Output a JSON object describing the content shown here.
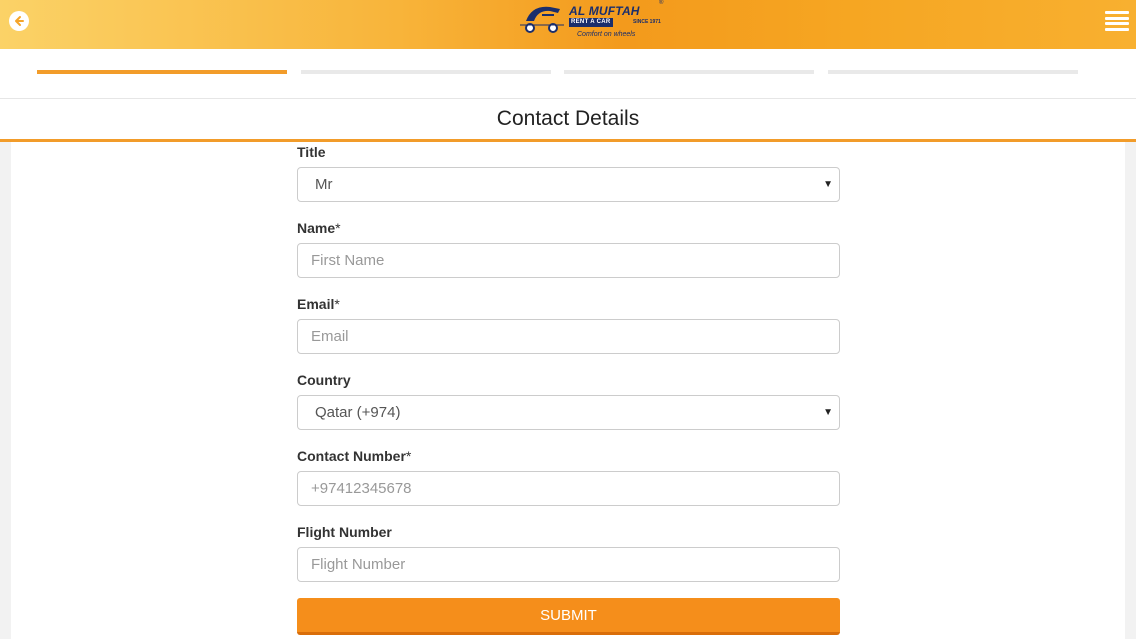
{
  "header": {
    "brand_name": "AL MUFTAH",
    "brand_sub": "RENT A CAR",
    "brand_since": "SINCE 1971",
    "brand_tagline": "Comfort on wheels",
    "brand_reg": "®"
  },
  "progress": {
    "total_steps": 4,
    "current_step": 1
  },
  "section": {
    "title": "Contact Details"
  },
  "form": {
    "title": {
      "label": "Title",
      "value": "Mr"
    },
    "name": {
      "label": "Name",
      "required_mark": "*",
      "placeholder": "First Name"
    },
    "email": {
      "label": "Email",
      "required_mark": "*",
      "placeholder": "Email"
    },
    "country": {
      "label": "Country",
      "value": "Qatar (+974)"
    },
    "contact": {
      "label": "Contact Number",
      "required_mark": "*",
      "placeholder": "+97412345678"
    },
    "flight": {
      "label": "Flight Number",
      "placeholder": "Flight Number"
    },
    "submit_label": "SUBMIT"
  },
  "icons": {
    "back": "back-arrow-icon",
    "menu": "hamburger-menu-icon",
    "dropdown": "dropdown-arrow-icon"
  },
  "colors": {
    "accent": "#f29c2a",
    "submit": "#f58e1b",
    "brand_navy": "#1a2e6c"
  }
}
